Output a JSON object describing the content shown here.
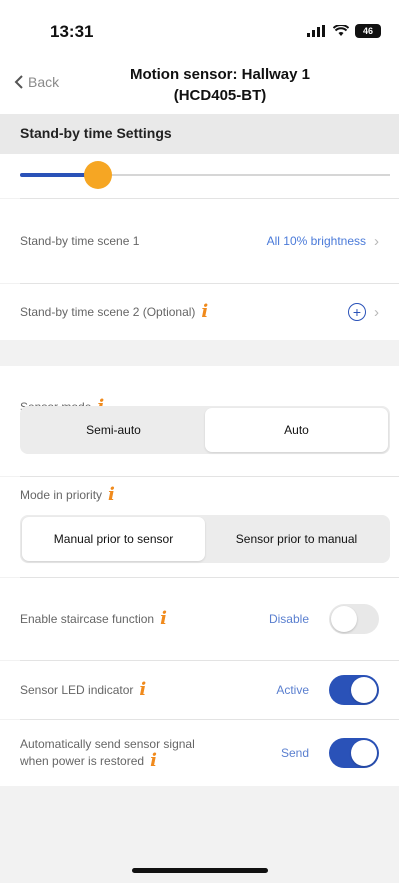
{
  "status": {
    "time": "13:31",
    "battery": "46"
  },
  "nav": {
    "back_label": "Back",
    "title_line1": "Motion sensor: Hallway 1",
    "title_line2": "(HCD405-BT)"
  },
  "standby": {
    "header": "Stand-by time Settings",
    "slider_fraction": 0.21,
    "scene1_label": "Stand-by time scene 1",
    "scene1_value": "All 10% brightness",
    "scene2_label": "Stand-by time scene 2 (Optional)"
  },
  "sensor_mode": {
    "label": "Sensor mode",
    "options": [
      "Semi-auto",
      "Auto"
    ],
    "selected": "Auto"
  },
  "priority": {
    "label": "Mode in priority",
    "options": [
      "Manual prior to sensor",
      "Sensor prior to manual"
    ],
    "selected": "Manual prior to sensor"
  },
  "staircase": {
    "label": "Enable staircase function",
    "state_label": "Disable",
    "enabled": false
  },
  "led": {
    "label": "Sensor LED indicator",
    "state_label": "Active",
    "enabled": true
  },
  "power": {
    "label_line1": "Automatically send sensor signal",
    "label_line2": "when power is restored",
    "state_label": "Send",
    "enabled": true
  },
  "colors": {
    "accent": "#2a52b8",
    "slider_thumb": "#f6a623",
    "info_icon": "#f08a1c",
    "link": "#4a7ad9"
  }
}
